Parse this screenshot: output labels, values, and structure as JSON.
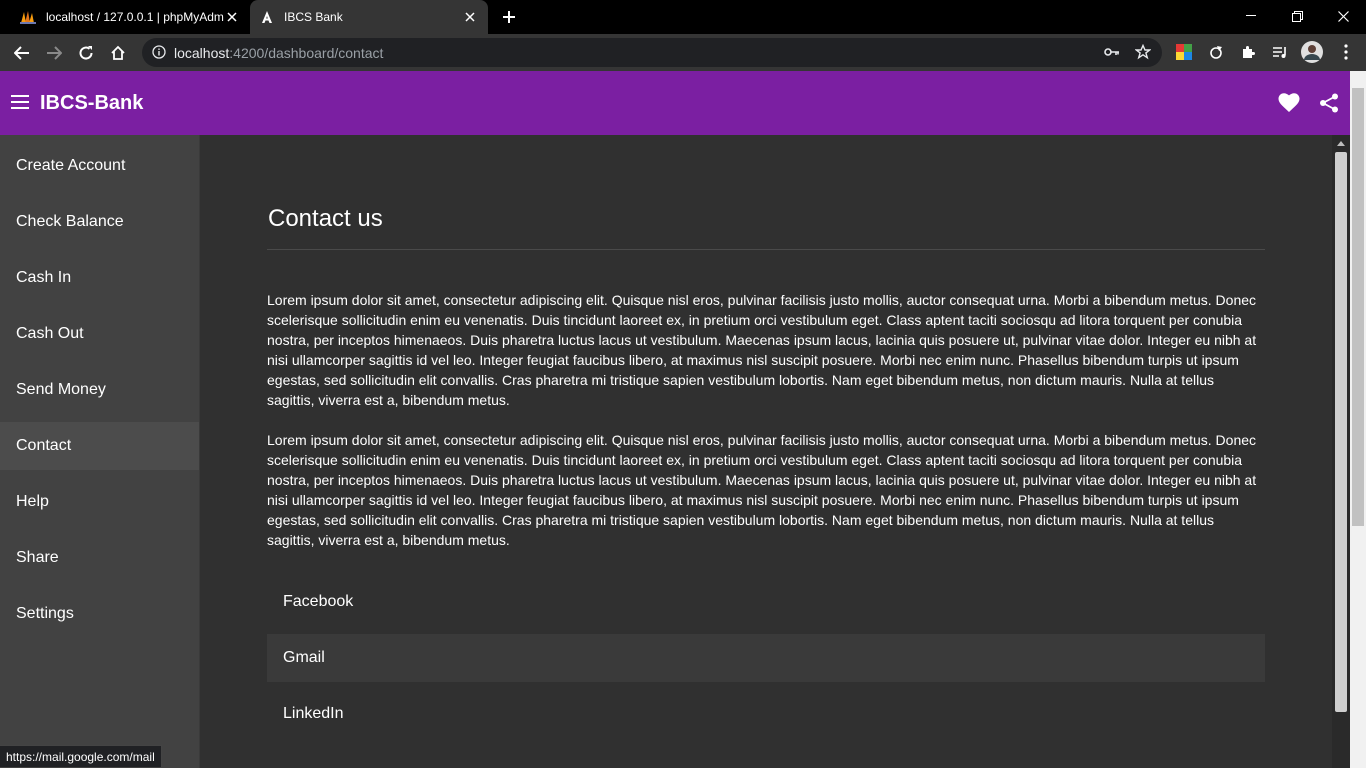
{
  "browser": {
    "tabs": [
      {
        "title": "localhost / 127.0.0.1 | phpMyAdmin",
        "icon": "phpmyadmin-icon"
      },
      {
        "title": "IBCS Bank",
        "icon": "angular-icon"
      }
    ],
    "url": {
      "host": "localhost",
      "rest": ":4200/dashboard/contact"
    },
    "status_url": "https://mail.google.com/mail"
  },
  "app": {
    "title": "IBCS-Bank",
    "accent": "#7b1fa2",
    "sidebar": [
      {
        "label": "Create Account"
      },
      {
        "label": "Check Balance"
      },
      {
        "label": "Cash In"
      },
      {
        "label": "Cash Out"
      },
      {
        "label": "Send Money"
      },
      {
        "label": "Contact"
      },
      {
        "label": "Help"
      },
      {
        "label": "Share"
      },
      {
        "label": "Settings"
      }
    ]
  },
  "page": {
    "title": "Contact us",
    "paragraphs": [
      "Lorem ipsum dolor sit amet, consectetur adipiscing elit. Quisque nisl eros, pulvinar facilisis justo mollis, auctor consequat urna. Morbi a bibendum metus. Donec scelerisque sollicitudin enim eu venenatis. Duis tincidunt laoreet ex, in pretium orci vestibulum eget. Class aptent taciti sociosqu ad litora torquent per conubia nostra, per inceptos himenaeos. Duis pharetra luctus lacus ut vestibulum. Maecenas ipsum lacus, lacinia quis posuere ut, pulvinar vitae dolor. Integer eu nibh at nisi ullamcorper sagittis id vel leo. Integer feugiat faucibus libero, at maximus nisl suscipit posuere. Morbi nec enim nunc. Phasellus bibendum turpis ut ipsum egestas, sed sollicitudin elit convallis. Cras pharetra mi tristique sapien vestibulum lobortis. Nam eget bibendum metus, non dictum mauris. Nulla at tellus sagittis, viverra est a, bibendum metus.",
      "Lorem ipsum dolor sit amet, consectetur adipiscing elit. Quisque nisl eros, pulvinar facilisis justo mollis, auctor consequat urna. Morbi a bibendum metus. Donec scelerisque sollicitudin enim eu venenatis. Duis tincidunt laoreet ex, in pretium orci vestibulum eget. Class aptent taciti sociosqu ad litora torquent per conubia nostra, per inceptos himenaeos. Duis pharetra luctus lacus ut vestibulum. Maecenas ipsum lacus, lacinia quis posuere ut, pulvinar vitae dolor. Integer eu nibh at nisi ullamcorper sagittis id vel leo. Integer feugiat faucibus libero, at maximus nisl suscipit posuere. Morbi nec enim nunc. Phasellus bibendum turpis ut ipsum egestas, sed sollicitudin elit convallis. Cras pharetra mi tristique sapien vestibulum lobortis. Nam eget bibendum metus, non dictum mauris. Nulla at tellus sagittis, viverra est a, bibendum metus."
    ],
    "links": [
      {
        "label": "Facebook"
      },
      {
        "label": "Gmail"
      },
      {
        "label": "LinkedIn"
      }
    ]
  }
}
